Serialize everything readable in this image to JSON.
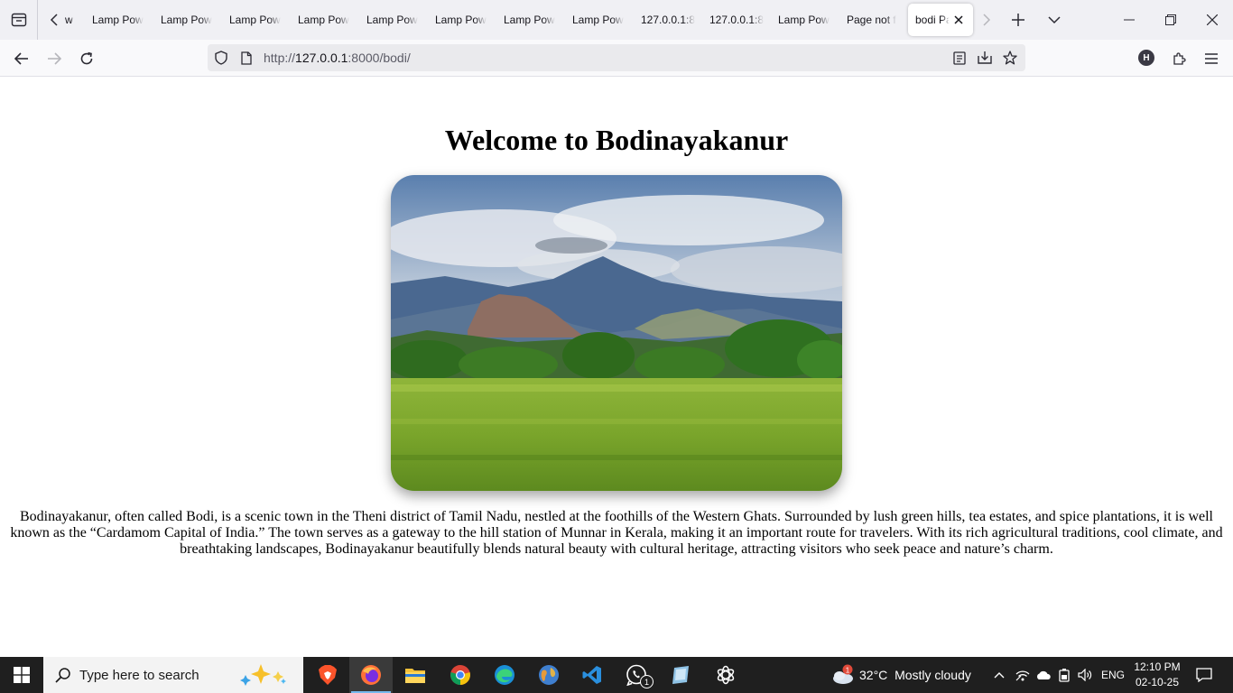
{
  "browser": {
    "tabs": [
      {
        "label": "w",
        "active": false
      },
      {
        "label": "Lamp Pow",
        "active": false
      },
      {
        "label": "Lamp Pow",
        "active": false
      },
      {
        "label": "Lamp Pow",
        "active": false
      },
      {
        "label": "Lamp Pow",
        "active": false
      },
      {
        "label": "Lamp Pow",
        "active": false
      },
      {
        "label": "Lamp Pow",
        "active": false
      },
      {
        "label": "Lamp Pow",
        "active": false
      },
      {
        "label": "Lamp Pow",
        "active": false
      },
      {
        "label": "127.0.0.1:8",
        "active": false
      },
      {
        "label": "127.0.0.1:8",
        "active": false
      },
      {
        "label": "Lamp Pow",
        "active": false
      },
      {
        "label": "Page not f",
        "active": false
      },
      {
        "label": "bodi Pa",
        "active": true
      }
    ],
    "url": {
      "scheme": "http://",
      "host": "127.0.0.1",
      "rest": ":8000/bodi/"
    },
    "profile_initial": "H"
  },
  "page": {
    "title": "Welcome to Bodinayakanur",
    "description": "Bodinayakanur, often called Bodi, is a scenic town in the Theni district of Tamil Nadu, nestled at the foothills of the Western Ghats. Surrounded by lush green hills, tea estates, and spice plantations, it is well known as the “Cardamom Capital of India.” The town serves as a gateway to the hill station of Munnar in Kerala, making it an important route for travelers. With its rich agricultural traditions, cool climate, and breathtaking landscapes, Bodinayakanur beautifully blends natural beauty with cultural heritage, attracting visitors who seek peace and nature’s charm."
  },
  "taskbar": {
    "search_placeholder": "Type here to search",
    "apps": [
      "brave-icon",
      "firefox-icon",
      "file-explorer-icon",
      "chrome-icon",
      "edge-icon",
      "globe-app-icon",
      "vscode-icon",
      "whatsapp-icon",
      "notes-app-icon",
      "chatgpt-icon"
    ],
    "whatsapp_badge": "1",
    "weather": {
      "badge": "1",
      "temp": "32°C",
      "condition": "Mostly cloudy"
    },
    "language": "ENG",
    "time": "12:10 PM",
    "date": "02-10-25"
  },
  "colors": {
    "tabbar_bg": "#f0f0f4",
    "urlbar_bg": "#eaeaed",
    "taskbar_bg": "#1f1f1f",
    "accent": "#76b9ed"
  }
}
